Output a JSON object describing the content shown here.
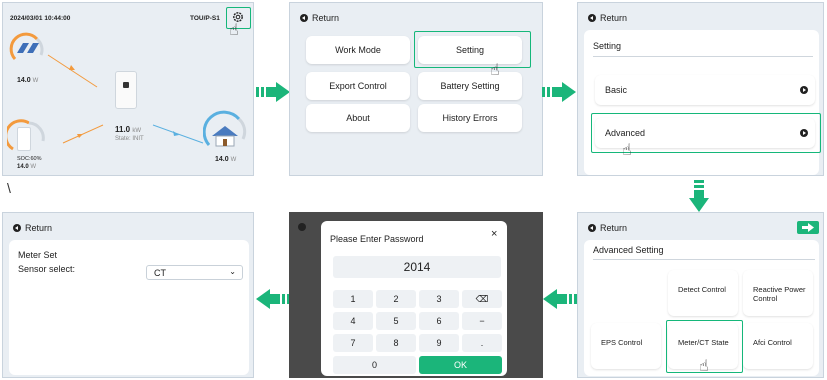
{
  "colors": {
    "accent": "#1bb57a",
    "panel_bg": "#e9eef3",
    "highlight": "#15b77a",
    "orange": "#f39a3d",
    "blue": "#5ab0e0"
  },
  "panel1": {
    "datetime": "2024/03/01 10:44:00",
    "mode_badge": "TOU/P-S1",
    "settings_icon": "gear-icon",
    "pv_power": "14.0",
    "pv_unit": "W",
    "inverter_power": "11.0",
    "inverter_unit": "kW",
    "inverter_state": "State: INIT",
    "battery_soc": "SOC:60%",
    "battery_power": "14.0",
    "battery_unit": "W",
    "home_power": "14.0",
    "home_unit": "W"
  },
  "panel2": {
    "return_label": "Return",
    "buttons": [
      "Work Mode",
      "Setting",
      "Export Control",
      "Battery Setting",
      "About",
      "History Errors"
    ]
  },
  "panel3": {
    "return_label": "Return",
    "title": "Setting",
    "items": [
      "Basic",
      "Advanced"
    ]
  },
  "stray_mark": "\\",
  "panel4": {
    "return_label": "Return",
    "title": "Advanced Setting",
    "tiles": [
      "Detect Control",
      "Reactive Power Control",
      "EPS Control",
      "Meter/CT State",
      "Afci Control"
    ]
  },
  "panel5": {
    "dialog_title": "Please Enter Password",
    "close": "×",
    "password_value": "2014",
    "keys": [
      "1",
      "2",
      "3",
      "⌫",
      "4",
      "5",
      "6",
      "−",
      "7",
      "8",
      "9",
      ".",
      "0",
      "OK"
    ]
  },
  "panel6": {
    "return_label": "Return",
    "title": "Meter Set",
    "sensor_label": "Sensor select:",
    "sensor_value": "CT"
  }
}
